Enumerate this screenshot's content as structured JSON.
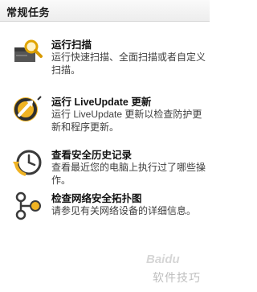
{
  "header": {
    "title": "常规任务"
  },
  "tasks": [
    {
      "icon": "scan-icon",
      "title": "运行扫描",
      "description": "运行快速扫描、全面扫描或者自定义扫描。"
    },
    {
      "icon": "liveupdate-icon",
      "title": "运行 LiveUpdate 更新",
      "description": "运行 LiveUpdate 更新以检查防护更新和程序更新。"
    },
    {
      "icon": "history-clock-icon",
      "title": "查看安全历史记录",
      "description": "查看最近您的电脑上执行过了哪些操作。"
    },
    {
      "icon": "network-map-icon",
      "title": "检查网络安全拓扑图",
      "description": "请参见有关网络设备的详细信息。"
    }
  ],
  "watermark": {
    "brand": "Baidu",
    "text": "软件技巧"
  },
  "colors": {
    "accent_yellow": "#f0b323",
    "icon_dark": "#3a3a3a"
  }
}
